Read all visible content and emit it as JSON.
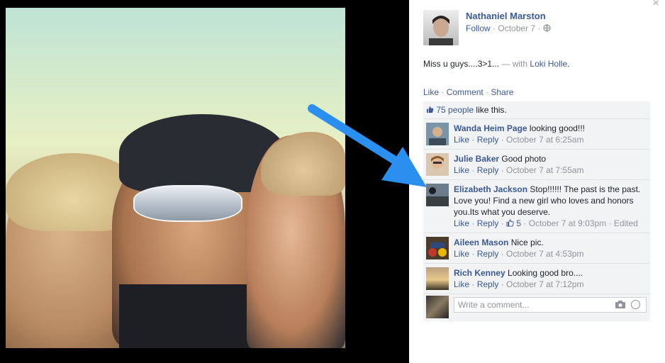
{
  "post": {
    "author": "Nathaniel Marston",
    "follow": "Follow",
    "date": "October 7",
    "dot": "·",
    "text": "Miss u guys....3>1...",
    "with_prefix": "— with",
    "tagged": "Loki Holle",
    "tagged_suffix": ".",
    "close_glyph": "×"
  },
  "actions": {
    "like": "Like",
    "comment": "Comment",
    "share": "Share",
    "sep": " · "
  },
  "likes": {
    "count_label": "75 people",
    "suffix": " like this."
  },
  "comments": [
    {
      "name": "Wanda Heim Page",
      "text": " looking good!!!",
      "like": "Like",
      "reply": "Reply",
      "time": "October 7 at 6:25am"
    },
    {
      "name": "Julie Baker",
      "text": " Good photo",
      "like": "Like",
      "reply": "Reply",
      "time": "October 7 at 7:55am"
    },
    {
      "name": "Elizabeth Jackson",
      "text": " Stop!!!!!! The past is the past. Love you! Find a new girl who loves and honors you.Its what you deserve.",
      "like": "Like",
      "reply": "Reply",
      "likes": "5",
      "time": "October 7 at 9:03pm",
      "edited": "Edited"
    },
    {
      "name": "Aileen Mason",
      "text": " Nice pic.",
      "like": "Like",
      "reply": "Reply",
      "time": "October 7 at 4:53pm"
    },
    {
      "name": "Rich Kenney",
      "text": " Looking good bro....",
      "like": "Like",
      "reply": "Reply",
      "time": "October 7 at 7:12pm"
    }
  ],
  "composer": {
    "placeholder": "Write a comment..."
  },
  "colors": {
    "link": "#3b5998",
    "meta": "#90949c",
    "arrow": "#2b8ff0"
  },
  "icons": [
    "close-icon",
    "globe-icon",
    "like-thumb-icon",
    "camera-icon",
    "smiley-icon",
    "arrow-annotation"
  ]
}
